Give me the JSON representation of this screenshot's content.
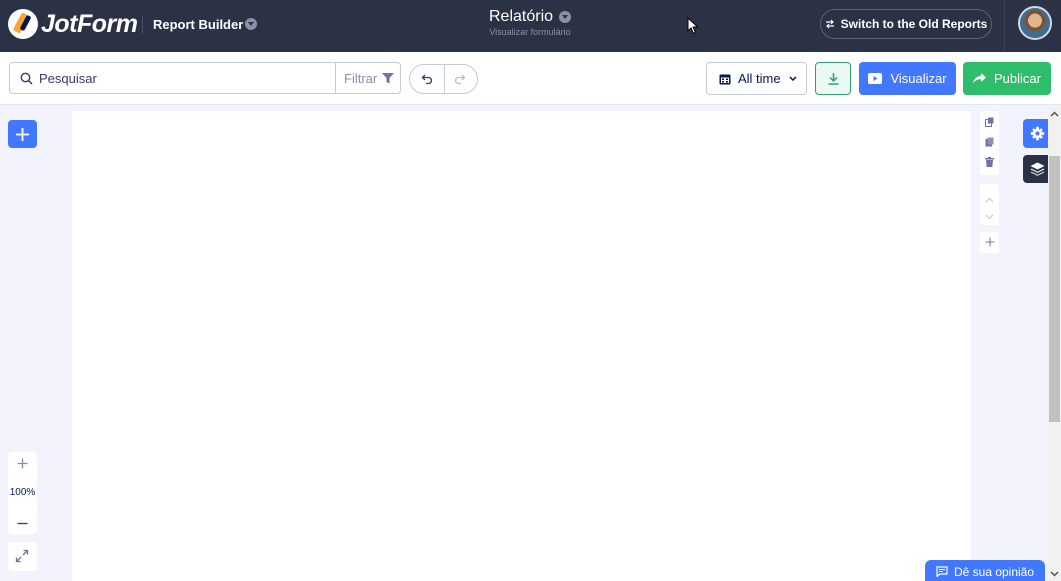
{
  "header": {
    "logo_text": "JotForm",
    "app_name": "Report Builder",
    "report_title": "Relatório",
    "report_subtitle": "Visualizar formulário",
    "old_reports_label": "Switch to the Old Reports"
  },
  "toolbar": {
    "search_text": "Pesquisar",
    "filter_label": "Filtrar",
    "time_range": "All time",
    "preview_label": "Visualizar",
    "publish_label": "Publicar"
  },
  "canvas": {
    "zoom_level": "100%"
  },
  "feedback": {
    "label": "Dê sua opinião"
  },
  "colors": {
    "header_bg": "#2b3245",
    "primary_blue": "#4277ff",
    "publish_green": "#2ebd6b",
    "download_green": "#2aa36a",
    "canvas_bg": "#f3f3fe"
  },
  "icons": [
    "search-icon",
    "filter-icon",
    "undo-icon",
    "redo-icon",
    "calendar-icon",
    "download-icon",
    "play-icon",
    "share-arrow-icon",
    "plus-icon",
    "gear-icon",
    "layers-icon",
    "swap-icon",
    "chevron-down-icon",
    "expand-icon",
    "duplicate-icon",
    "copy-icon",
    "trash-icon",
    "feedback-icon"
  ]
}
